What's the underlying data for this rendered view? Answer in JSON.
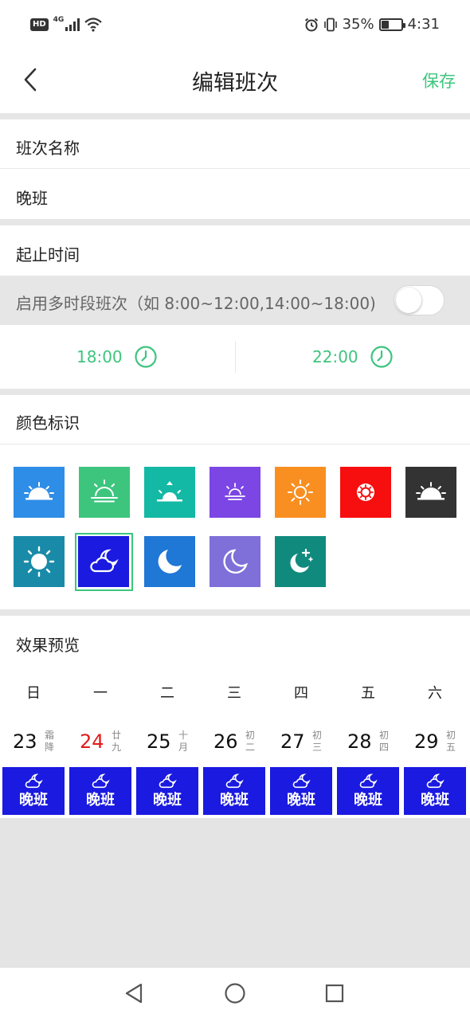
{
  "status_bar": {
    "hd": "HD",
    "network": "4G",
    "battery_percent": "35%",
    "battery_level": 0.35,
    "time": "4:31",
    "icons": [
      "hd-icon",
      "signal-icon",
      "wifi-icon",
      "alarm-icon",
      "vibrate-icon",
      "battery-icon"
    ]
  },
  "header": {
    "title": "编辑班次",
    "save_label": "保存",
    "back_icon": "chevron-left-icon"
  },
  "name_section": {
    "title": "班次名称",
    "value": "晚班"
  },
  "time_section": {
    "title": "起止时间",
    "multi_label": "启用多时段班次（如 8:00~12:00,14:00~18:00)",
    "multi_enabled": false,
    "start_time": "18:00",
    "end_time": "22:00",
    "clock_icon": "clock-icon"
  },
  "color_section": {
    "title": "颜色标识",
    "selected_index": 8,
    "options": [
      {
        "color": "#2e8de6",
        "icon": "sunrise-icon"
      },
      {
        "color": "#3dc57e",
        "icon": "sunrise-outline-icon"
      },
      {
        "color": "#13b9a5",
        "icon": "sunrise-up-icon"
      },
      {
        "color": "#7c46e4",
        "icon": "sunset-icon"
      },
      {
        "color": "#f98f20",
        "icon": "sun-outline-icon"
      },
      {
        "color": "#f70e0e",
        "icon": "sun-icon"
      },
      {
        "color": "#333333",
        "icon": "sunset-dark-icon"
      },
      {
        "color": "#198ba8",
        "icon": "sun-full-icon"
      },
      {
        "color": "#1a1ae0",
        "icon": "cloud-moon-icon"
      },
      {
        "color": "#1f77d6",
        "icon": "moon-icon"
      },
      {
        "color": "#7f6fd8",
        "icon": "moon-outline-icon"
      },
      {
        "color": "#118a7e",
        "icon": "moon-stars-icon"
      }
    ]
  },
  "preview_section": {
    "title": "效果预览",
    "weekdays": [
      "日",
      "一",
      "二",
      "三",
      "四",
      "五",
      "六"
    ],
    "days": [
      {
        "date": "23",
        "lunar": "霜降",
        "today": false
      },
      {
        "date": "24",
        "lunar": "廿九",
        "today": true
      },
      {
        "date": "25",
        "lunar": "十月",
        "today": false
      },
      {
        "date": "26",
        "lunar": "初二",
        "today": false
      },
      {
        "date": "27",
        "lunar": "初三",
        "today": false
      },
      {
        "date": "28",
        "lunar": "初四",
        "today": false
      },
      {
        "date": "29",
        "lunar": "初五",
        "today": false
      }
    ],
    "shift_label": "晚班",
    "shift_color": "#1a1ae0",
    "today_color": "#e21b1b"
  },
  "nav_bar": {
    "buttons": [
      "back-triangle-icon",
      "home-circle-icon",
      "recents-square-icon"
    ]
  },
  "theme": {
    "accent": "#3dc57e"
  }
}
